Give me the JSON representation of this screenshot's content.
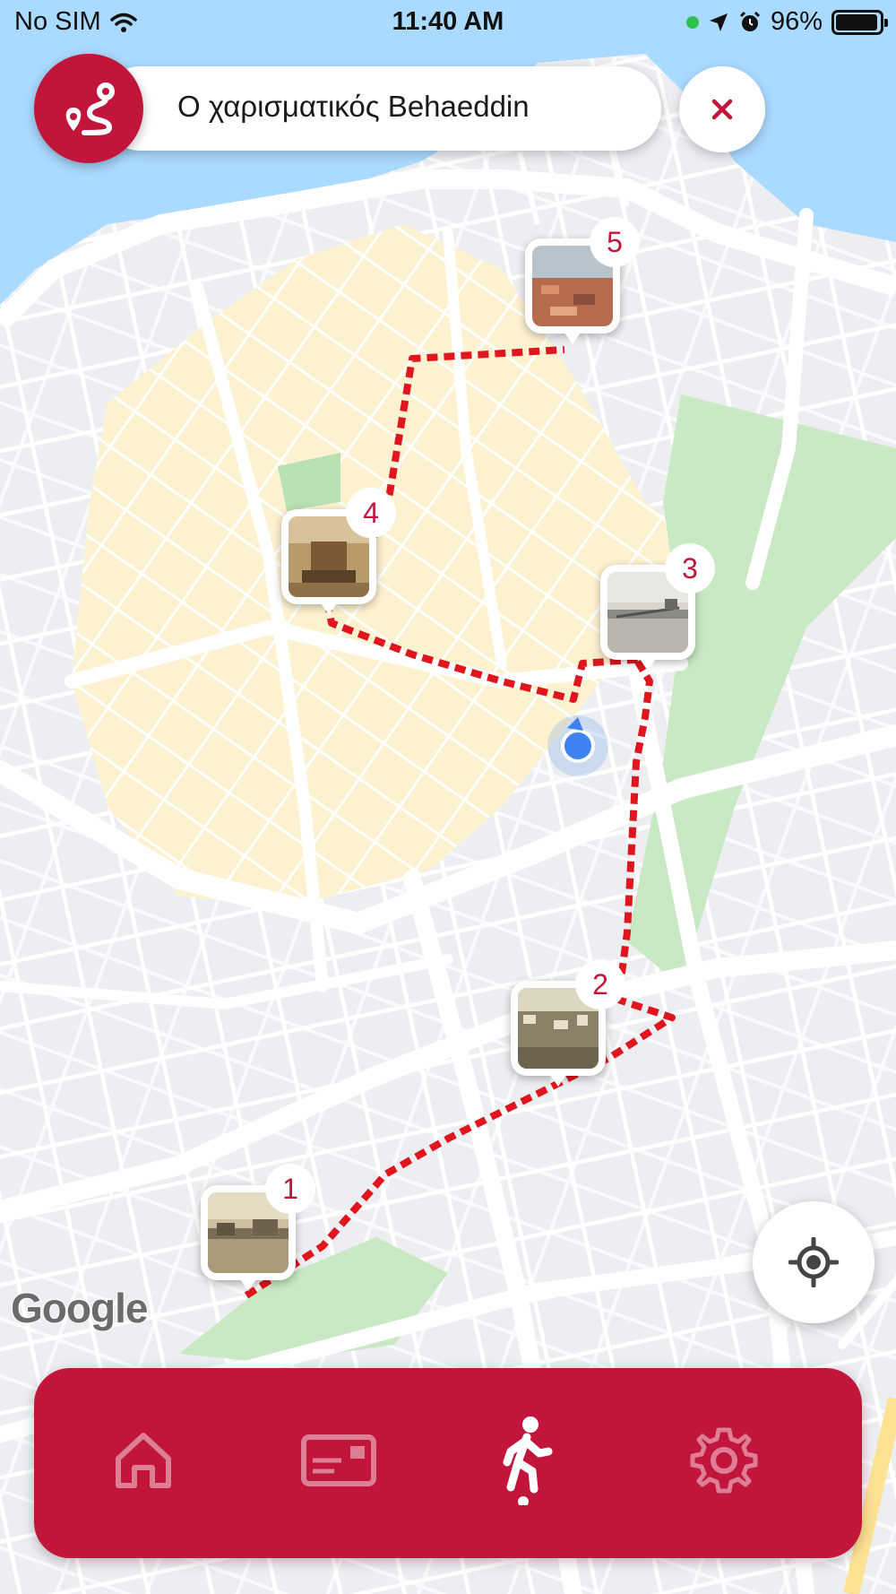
{
  "status_bar": {
    "carrier": "No SIM",
    "time": "11:40 AM",
    "battery": "96%",
    "battery_level": 0.96,
    "icons": [
      "wifi-icon",
      "location-arrow-icon",
      "alarm-icon",
      "battery-icon"
    ]
  },
  "header": {
    "route_title": "Ο χαρισματικός Behaeddin",
    "route_icon": "route-icon",
    "close_icon": "close-icon"
  },
  "map": {
    "attribution": "Google",
    "stops": [
      {
        "number": "1",
        "thumbnail": "vintage-postcard-harbor"
      },
      {
        "number": "2",
        "thumbnail": "vintage-postcard-city"
      },
      {
        "number": "3",
        "thumbnail": "vintage-postcard-pier"
      },
      {
        "number": "4",
        "thumbnail": "vintage-postcard-fountain"
      },
      {
        "number": "5",
        "thumbnail": "vintage-postcard-rooftops"
      }
    ],
    "locate_icon": "my-location-icon"
  },
  "bottom_nav": {
    "items": [
      {
        "icon": "home-icon",
        "active": false
      },
      {
        "icon": "postcard-icon",
        "active": false
      },
      {
        "icon": "walking-icon",
        "active": true
      },
      {
        "icon": "settings-icon",
        "active": false
      }
    ]
  },
  "colors": {
    "accent": "#c1153c",
    "route_line": "#e0161e",
    "user_location": "#3d82f0",
    "old_town": "#fdf2d0",
    "sea": "#aadaff",
    "park": "#c9e8c4"
  }
}
